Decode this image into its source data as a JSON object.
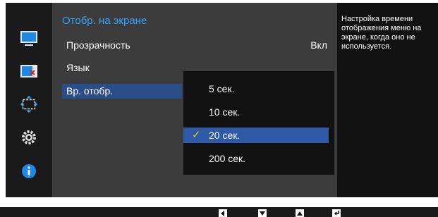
{
  "menu": {
    "title": "Отобр. на экране",
    "rows": [
      {
        "label": "Прозрачность",
        "value": "Вкл"
      },
      {
        "label": "Язык",
        "value": ""
      },
      {
        "label": "Вр. отобр.",
        "value": ""
      }
    ]
  },
  "dropdown": {
    "options": [
      "5 сек.",
      "10 сек.",
      "20 сек.",
      "200 сек."
    ],
    "selected": "20 сек."
  },
  "help": {
    "text": "Настройка времени отображения меню на экране, когда оно не используется."
  },
  "sidebar_icons": [
    "picture-icon",
    "color-icon",
    "size-position-icon",
    "setup-icon",
    "information-icon"
  ],
  "nav_keys": [
    "left-key-icon",
    "down-key-icon",
    "up-key-icon",
    "enter-key-icon"
  ],
  "colors": {
    "accent": "#33a3ff",
    "selected_row": "#2c4e88",
    "selected_option": "#2f5aa8",
    "checkmark": "#f0c020"
  }
}
